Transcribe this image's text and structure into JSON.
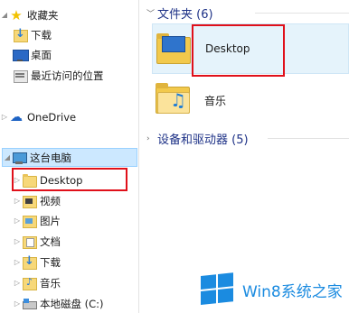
{
  "nav": {
    "favorites": "收藏夹",
    "downloads": "下载",
    "desktop": "桌面",
    "recent": "最近访问的位置",
    "onedrive": "OneDrive",
    "this_pc": "这台电脑",
    "pc_items": [
      "Desktop",
      "视频",
      "图片",
      "文档",
      "下载",
      "音乐",
      "本地磁盘 (C:)"
    ]
  },
  "content": {
    "folders_header": "文件夹 (6)",
    "devices_header": "设备和驱动器 (5)",
    "folders": [
      "Desktop",
      "音乐"
    ]
  },
  "watermark": "Win8系统之家",
  "colors": {
    "accent": "#1e3287",
    "highlight_box": "#e0101a",
    "selection": "#cce8ff",
    "watermark": "#1b8be0"
  }
}
